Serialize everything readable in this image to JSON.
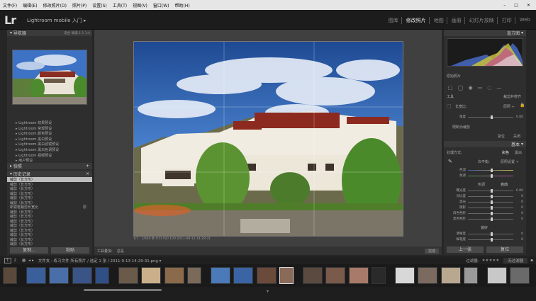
{
  "menubar": {
    "items": [
      "文件(F)",
      "编辑(E)",
      "修改照片(D)",
      "照片(P)",
      "设置(S)",
      "工具(T)",
      "视图(V)",
      "窗口(W)",
      "帮助(H)"
    ]
  },
  "header": {
    "logo": "Lr",
    "app_title": "Lightroom mobile 入门 ▸",
    "modules": [
      "图库",
      "修改照片",
      "地图",
      "画册",
      "幻灯片放映",
      "打印",
      "Web"
    ],
    "active_module": "修改照片"
  },
  "left": {
    "navigator_title": "导航器",
    "navigator_zoom": "适合  填满  1:1  1:4",
    "presets": [
      "Lightroom 效果预设",
      "Lightroom 常规预设",
      "Lightroom 颜色预设",
      "Lightroom 黑白预设",
      "Lightroom 黑白滤镜预设",
      "Lightroom 黑白色调预设",
      "Lightroom 视频预设",
      "用户预设"
    ],
    "snapshots_title": "快照",
    "history_title": "历史记录",
    "history": [
      {
        "label": "裁剪（长方形）",
        "selected": true,
        "value": ""
      },
      {
        "label": "裁剪（长方形）",
        "selected": false,
        "value": ""
      },
      {
        "label": "裁剪（长方形）",
        "selected": false,
        "value": ""
      },
      {
        "label": "裁剪（长方形）",
        "selected": false,
        "value": ""
      },
      {
        "label": "裁剪（长方形）",
        "selected": false,
        "value": ""
      },
      {
        "label": "裁剪（长方形）",
        "selected": false,
        "value": ""
      },
      {
        "label": "新镜框裁剪长宽比",
        "selected": false,
        "value": "原"
      },
      {
        "label": "裁剪（长方形）",
        "selected": false,
        "value": ""
      },
      {
        "label": "裁剪（长方形）",
        "selected": false,
        "value": ""
      },
      {
        "label": "裁剪（长方形）",
        "selected": false,
        "value": ""
      },
      {
        "label": "裁剪（长方形）",
        "selected": false,
        "value": ""
      },
      {
        "label": "裁剪（长方形）",
        "selected": false,
        "value": ""
      },
      {
        "label": "裁剪（长方形）",
        "selected": false,
        "value": ""
      },
      {
        "label": "裁剪（长方形）",
        "selected": false,
        "value": ""
      },
      {
        "label": "裁剪（长方形）",
        "selected": false,
        "value": ""
      }
    ],
    "copy_button": "复制...",
    "paste_button": "粘贴"
  },
  "center": {
    "caption": "1/7  ·  1/640 秒 f/11  ISO 100   2011-09-13 14:29:31",
    "toolbar_label": "工具叠加:",
    "toolbar_value": "总是",
    "done_button": "完成"
  },
  "right": {
    "histogram_title": "直方图",
    "original_photo": "原始照片",
    "tool_label": "工具",
    "crop_label": "裁剪并修齐",
    "aspect_label": "长宽比:",
    "aspect_value": "原照 ÷",
    "angle_label": "角度",
    "angle_value": "0.00",
    "constrain_label": "限制为裁剪",
    "reset_button": "复位",
    "close_button": "关闭",
    "basic_title": "基本",
    "treatment_label": "处理方式:",
    "treatment_color": "彩色",
    "treatment_bw": "黑白",
    "wb_label": "白平衡:",
    "wb_value": "原照设置 ÷",
    "temp_label": "色温",
    "tint_label": "色调",
    "tone_label": "色调",
    "tone_auto": "自动",
    "sliders": [
      {
        "label": "曝光度",
        "value": "0.00",
        "pos": 50
      },
      {
        "label": "对比度",
        "value": "0",
        "pos": 50
      },
      {
        "label": "高光",
        "value": "0",
        "pos": 50
      },
      {
        "label": "阴影",
        "value": "0",
        "pos": 50
      },
      {
        "label": "白色色阶",
        "value": "0",
        "pos": 50
      },
      {
        "label": "黑色色阶",
        "value": "0",
        "pos": 50
      }
    ],
    "presence_label": "偏好",
    "presence_sliders": [
      {
        "label": "清晰度",
        "value": "0",
        "pos": 50
      },
      {
        "label": "鲜艳度",
        "value": "0",
        "pos": 50
      }
    ],
    "prev_button": "上一张",
    "reset2_button": "复位"
  },
  "filmbar": {
    "page_nums": [
      "1",
      "2"
    ],
    "path": "文件夹 : 练习文件   所有照片 / 选定 1 张 / 2011-9-13 14-29-31.png ▾",
    "filter_label": "过滤器:",
    "filter_value": "无过滤器"
  },
  "colors": {
    "accent": "#e8e8e8",
    "panel": "#2e2e2e",
    "sky": "#2a4d8a"
  }
}
